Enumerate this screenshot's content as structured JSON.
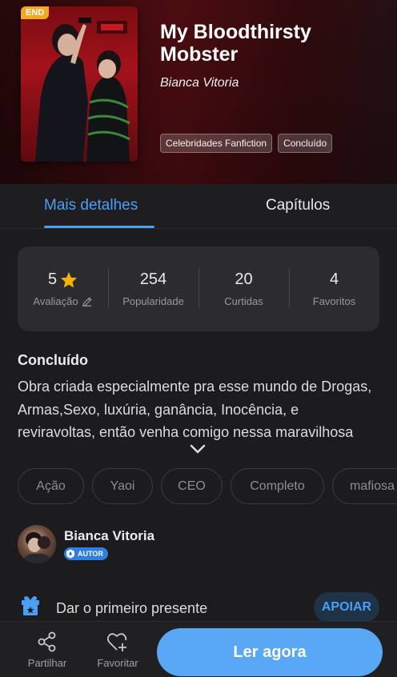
{
  "hero": {
    "badge": "END",
    "title": "My Bloodthirsty Mobster",
    "author": "Bianca Vitoria",
    "tags": [
      "Celebridades Fanfiction",
      "Concluído"
    ]
  },
  "tabs": {
    "details": "Mais detalhes",
    "chapters": "Capítulos"
  },
  "stats": {
    "rating": {
      "value": "5",
      "label": "Avaliação"
    },
    "popularity": {
      "value": "254",
      "label": "Popularidade"
    },
    "likes": {
      "value": "20",
      "label": "Curtidas"
    },
    "favorites": {
      "value": "4",
      "label": "Favoritos"
    }
  },
  "status": "Concluído",
  "description": "Obra criada especialmente pra esse mundo de Drogas, Armas,Sexo, luxúria, ganância, Inocência, e reviravoltas, então venha comigo nessa maravilhosa",
  "genres": [
    "Ação",
    "Yaoi",
    "CEO",
    "Completo",
    "mafiosa"
  ],
  "author": {
    "name": "Bianca Vitoria",
    "badge": "AUTOR"
  },
  "gift": {
    "text": "Dar o primeiro presente",
    "button": "APOIAR"
  },
  "bottom": {
    "share": "Partilhar",
    "favorite": "Favoritar",
    "read": "Ler agora"
  },
  "colors": {
    "accent": "#4a9ff5",
    "badge": "#f5a623",
    "star": "#f5b400"
  }
}
